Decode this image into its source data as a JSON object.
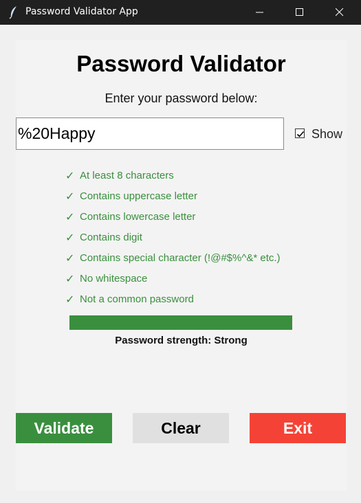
{
  "window": {
    "title": "Password Validator App",
    "icon": "feather-icon"
  },
  "main": {
    "heading": "Password Validator",
    "subheading": "Enter your password below:",
    "password_value": "%20Happy",
    "show_label": "Show",
    "show_checked": true
  },
  "checks": [
    {
      "mark": "✓",
      "label": "At least 8 characters"
    },
    {
      "mark": "✓",
      "label": "Contains uppercase letter"
    },
    {
      "mark": "✓",
      "label": "Contains lowercase letter"
    },
    {
      "mark": "✓",
      "label": "Contains digit"
    },
    {
      "mark": "✓",
      "label": "Contains special character (!@#$%^&* etc.)"
    },
    {
      "mark": "✓",
      "label": "No whitespace"
    },
    {
      "mark": "✓",
      "label": "Not a common password"
    }
  ],
  "strength": {
    "label": "Password strength: Strong",
    "level_percent": 100
  },
  "buttons": {
    "validate": "Validate",
    "clear": "Clear",
    "exit": "Exit"
  },
  "colors": {
    "pass_green": "#3a8f3e",
    "exit_red": "#f44336",
    "clear_gray": "#e0e0e0",
    "titlebar": "#202020"
  }
}
